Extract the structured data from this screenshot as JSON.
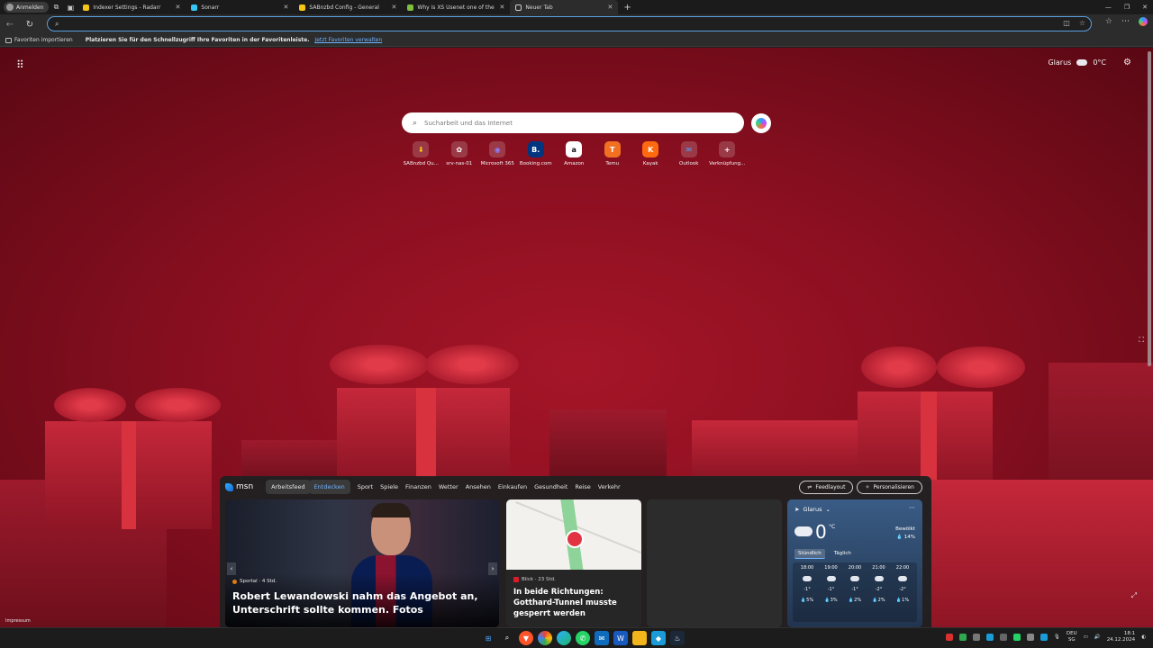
{
  "browser": {
    "profile_label": "Anmelden",
    "tabs": [
      {
        "title": "Indexer Settings - Radarr",
        "fav_color": "#f5c518"
      },
      {
        "title": "Sonarr",
        "fav_color": "#35c5f4"
      },
      {
        "title": "SABnzbd Config - General",
        "fav_color": "#f5c518"
      },
      {
        "title": "Why is XS Usenet one of the safest...",
        "fav_color": "#7fbf3f"
      },
      {
        "title": "Neuer Tab",
        "fav_color": "#cfcfcf"
      }
    ],
    "new_tab_symbol": "+",
    "window_buttons": [
      "—",
      "❐",
      "✕"
    ],
    "address_value": ""
  },
  "favorites_bar": {
    "import_label": "Favoriten importieren",
    "message": "Platzieren Sie für den Schnellzugriff Ihre Favoriten in der Favoritenleiste.",
    "manage_link": "Jetzt Favoriten verwalten"
  },
  "ntp": {
    "weather": {
      "location": "Glarus",
      "temp": "0°C"
    },
    "search_placeholder": "Sucharbeit und das Internet",
    "quick_links": [
      {
        "label": "SABnzbd Qu...",
        "glyph": "⬇",
        "color": "#f5c518"
      },
      {
        "label": "srv-nas-01",
        "glyph": "✿",
        "color": "#3a3a3a"
      },
      {
        "label": "Microsoft 365",
        "glyph": "◉",
        "color": "#5a4dd8"
      },
      {
        "label": "Booking.com",
        "glyph": "B.",
        "color": "#003580"
      },
      {
        "label": "Amazon",
        "glyph": "a",
        "color": "#222222"
      },
      {
        "label": "Temu",
        "glyph": "T",
        "color": "#f27022"
      },
      {
        "label": "Kayak",
        "glyph": "K",
        "color": "#ff690f"
      },
      {
        "label": "Outlook",
        "glyph": "✉",
        "color": "#0f6cbd"
      },
      {
        "label": "Verknüpfung...",
        "glyph": "+",
        "color": "#5a5a5a"
      }
    ],
    "impressum": "Impressum"
  },
  "feed": {
    "brand": "msn",
    "nav": [
      "Arbeitsfeed",
      "Entdecken",
      "Sport",
      "Spiele",
      "Finanzen",
      "Wetter",
      "Ansehen",
      "Einkaufen",
      "Gesundheit",
      "Reise",
      "Verkehr"
    ],
    "feed_layout_label": "Feedlayout",
    "personalize_label": "Personalisieren",
    "main_card": {
      "source": "Sportal · 4 Std.",
      "headline": "Robert Lewandowski nahm das Angebot an, Unterschrift sollte kommen. Fotos"
    },
    "map_card": {
      "source": "Blick · 23 Std.",
      "headline": "In beide Richtungen: Gotthard-Tunnel musste gesperrt werden"
    },
    "weather_card": {
      "location": "Glarus",
      "temp": "0",
      "unit": "°C",
      "condition": "Bewölkt",
      "precip": "💧 14%",
      "tab_hourly": "Stündlich",
      "tab_daily": "Täglich",
      "hours": [
        {
          "time": "18:00",
          "temp": "-1°",
          "precip": "💧5%"
        },
        {
          "time": "19:00",
          "temp": "-1°",
          "precip": "💧3%"
        },
        {
          "time": "20:00",
          "temp": "-1°",
          "precip": "💧2%"
        },
        {
          "time": "21:00",
          "temp": "-2°",
          "precip": "💧2%"
        },
        {
          "time": "22:00",
          "temp": "-2°",
          "precip": "💧1%"
        }
      ]
    }
  },
  "taskbar": {
    "lang_top": "DEU",
    "lang_bottom": "SG",
    "time": "18:1",
    "date": "24.12.2024"
  }
}
